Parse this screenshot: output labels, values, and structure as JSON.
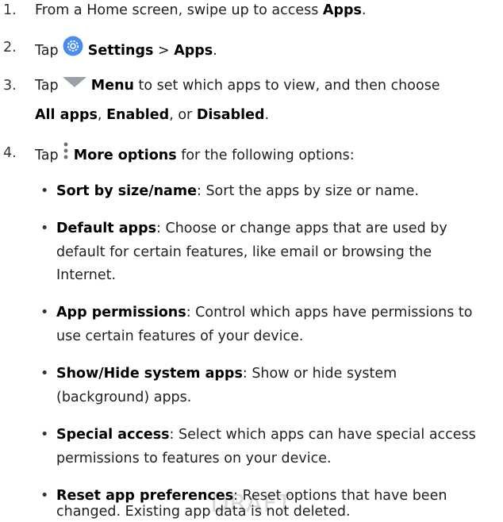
{
  "steps": [
    {
      "num": "1.",
      "p1": "From a Home screen, swipe up to access ",
      "b1": "Apps",
      "p2": "."
    },
    {
      "num": "2.",
      "p1": "Tap ",
      "icon": "settings-gear-icon",
      "b1": "Settings",
      "p2": " > ",
      "b2": "Apps",
      "p3": "."
    },
    {
      "num": "3.",
      "p1": "Tap ",
      "icon": "menu-triangle-icon",
      "b1": "Menu",
      "p2": " to set which apps to view, and then choose",
      "b2": "All apps",
      "p3": ", ",
      "b3": "Enabled",
      "p4": ", or ",
      "b4": "Disabled",
      "p5": "."
    },
    {
      "num": "4.",
      "p1": "Tap ",
      "icon": "more-options-icon",
      "b1": "More options",
      "p2": " for the following options:"
    }
  ],
  "options": [
    {
      "bullet": "•",
      "term": "Sort by size/name",
      "desc": [
        ": Sort the apps by size or name."
      ]
    },
    {
      "bullet": "•",
      "term": "Default apps",
      "desc": [
        ": Choose or change apps that are used by",
        "default for certain features, like email or browsing the",
        "Internet."
      ]
    },
    {
      "bullet": "•",
      "term": "App permissions",
      "desc": [
        ": Control which apps have permissions to",
        "use certain features of your device."
      ]
    },
    {
      "bullet": "•",
      "term": "Show/Hide system apps",
      "desc": [
        ": Show or hide system",
        "(background) apps."
      ]
    },
    {
      "bullet": "•",
      "term": "Special access",
      "desc": [
        ": Select which apps can have special access",
        "permissions to features on your device."
      ]
    },
    {
      "bullet": "•",
      "term": "Reset app preferences",
      "desc": [
        ": Reset options that have been",
        "changed. Existing app data is not deleted."
      ]
    }
  ],
  "watermark": "DRAFT",
  "colors": {
    "settings_icon": "#4a8df0",
    "menu_icon": "#9aa0a8",
    "more_icon": "#6e6e6e"
  }
}
